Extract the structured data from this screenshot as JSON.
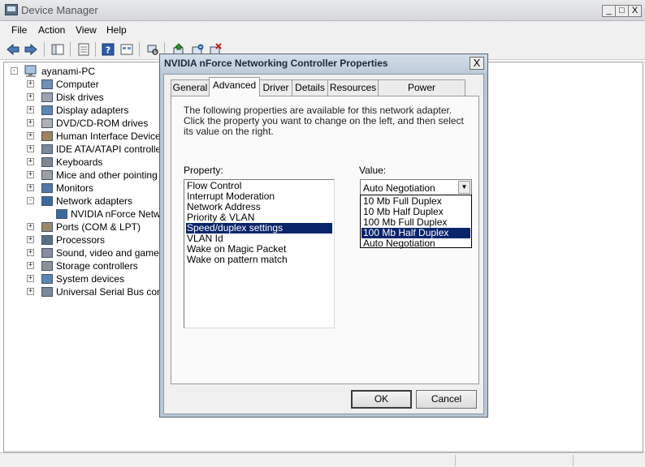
{
  "window": {
    "title": "Device Manager",
    "minimize_glyph": "_",
    "maximize_glyph": "□",
    "close_glyph": "X"
  },
  "menu": [
    "File",
    "Action",
    "View",
    "Help"
  ],
  "toolbar_icons": [
    "back-arrow-icon",
    "forward-arrow-icon",
    "show-hide-tree-icon",
    "properties-icon",
    "help-icon",
    "view-icon",
    "scan-hardware-icon",
    "update-driver-icon",
    "disable-device-icon",
    "uninstall-device-icon"
  ],
  "tree": {
    "root": "ayanami-PC",
    "items": [
      {
        "label": "Computer",
        "icon": "computer-icon",
        "expander": "+"
      },
      {
        "label": "Disk drives",
        "icon": "disk-drive-icon",
        "expander": "+"
      },
      {
        "label": "Display adapters",
        "icon": "display-adapter-icon",
        "expander": "+"
      },
      {
        "label": "DVD/CD-ROM drives",
        "icon": "dvd-drive-icon",
        "expander": "+"
      },
      {
        "label": "Human Interface Devices",
        "icon": "hid-icon",
        "expander": "+"
      },
      {
        "label": "IDE ATA/ATAPI controllers",
        "icon": "ide-controller-icon",
        "expander": "+"
      },
      {
        "label": "Keyboards",
        "icon": "keyboard-icon",
        "expander": "+"
      },
      {
        "label": "Mice and other pointing devices",
        "icon": "mouse-icon",
        "expander": "+"
      },
      {
        "label": "Monitors",
        "icon": "monitor-icon",
        "expander": "+"
      },
      {
        "label": "Network adapters",
        "icon": "network-adapter-icon",
        "expander": "-"
      },
      {
        "label": "NVIDIA nForce Networking Controller",
        "icon": "network-card-icon",
        "child": true
      },
      {
        "label": "Ports (COM & LPT)",
        "icon": "port-icon",
        "expander": "+"
      },
      {
        "label": "Processors",
        "icon": "processor-icon",
        "expander": "+"
      },
      {
        "label": "Sound, video and game controllers",
        "icon": "sound-icon",
        "expander": "+"
      },
      {
        "label": "Storage controllers",
        "icon": "storage-icon",
        "expander": "+"
      },
      {
        "label": "System devices",
        "icon": "system-device-icon",
        "expander": "+"
      },
      {
        "label": "Universal Serial Bus controllers",
        "icon": "usb-icon",
        "expander": "+"
      }
    ]
  },
  "dialog": {
    "title": "NVIDIA nForce Networking Controller Properties",
    "close_glyph": "X",
    "tabs": [
      "General",
      "Advanced",
      "Driver",
      "Details",
      "Resources",
      "Power Management"
    ],
    "active_tab": "Advanced",
    "description": "The following properties are available for this network adapter. Click the property you want to change on the left, and then select its value on the right.",
    "property_label": "Property:",
    "value_label": "Value:",
    "properties": [
      "Flow Control",
      "Interrupt Moderation",
      "Network Address",
      "Priority & VLAN",
      "Speed/duplex settings",
      "VLAN Id",
      "Wake on Magic Packet",
      "Wake on pattern match"
    ],
    "selected_property": "Speed/duplex settings",
    "value_current": "Auto Negotiation",
    "value_options": [
      "10 Mb Full Duplex",
      "10 Mb Half Duplex",
      "100 Mb Full Duplex",
      "100 Mb Half Duplex",
      "Auto Negotiation"
    ],
    "highlighted_option": "100 Mb Half Duplex",
    "ok_label": "OK",
    "cancel_label": "Cancel",
    "selection_color": "#0a246a"
  }
}
